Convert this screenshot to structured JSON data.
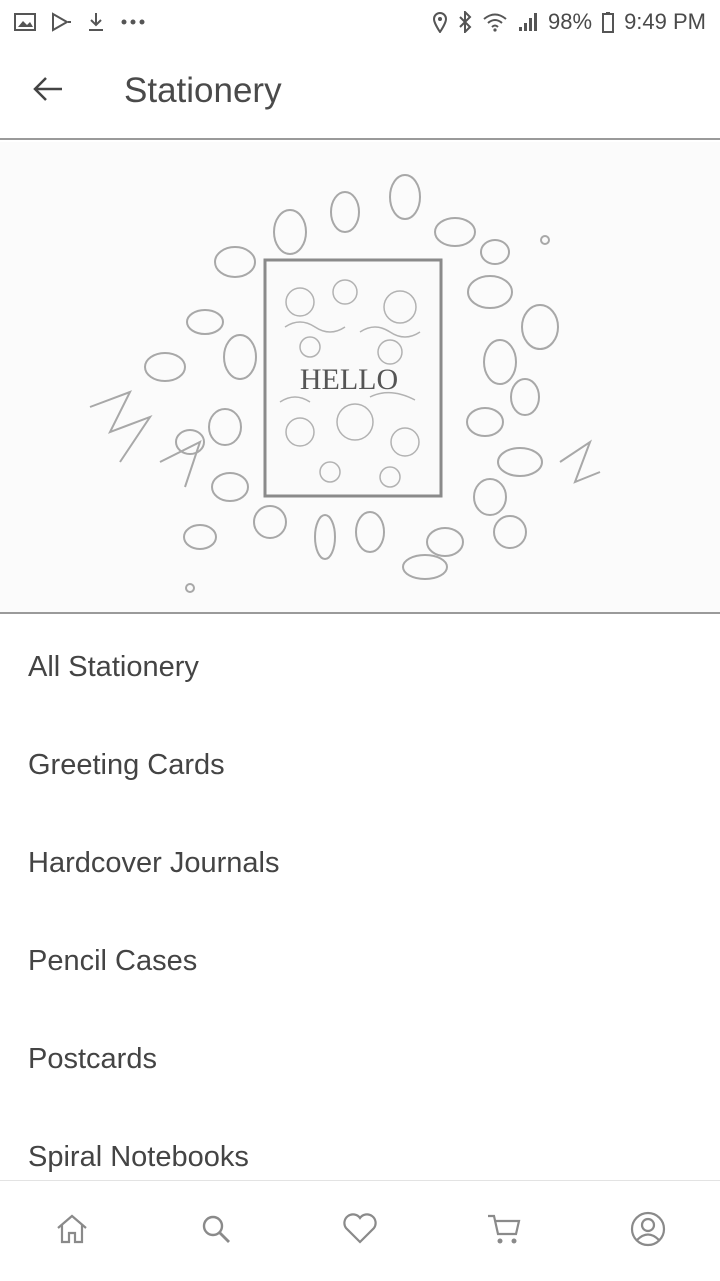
{
  "status_bar": {
    "left_icons": [
      "gallery-icon",
      "play-store-icon",
      "download-icon",
      "more-dots-icon"
    ],
    "right_icons": [
      "location-icon",
      "bluetooth-icon",
      "wifi-icon",
      "signal-icon",
      "battery-icon"
    ],
    "battery": "98%",
    "time": "9:49 PM"
  },
  "header": {
    "title": "Stationery",
    "back_icon": "arrow-left-icon"
  },
  "hero": {
    "card_text": "HELLO"
  },
  "categories": [
    {
      "label": "All Stationery"
    },
    {
      "label": "Greeting Cards"
    },
    {
      "label": "Hardcover Journals"
    },
    {
      "label": "Pencil Cases"
    },
    {
      "label": "Postcards"
    },
    {
      "label": "Spiral Notebooks"
    }
  ],
  "bottom_nav": [
    "home-icon",
    "search-icon",
    "heart-icon",
    "cart-icon",
    "account-icon"
  ]
}
